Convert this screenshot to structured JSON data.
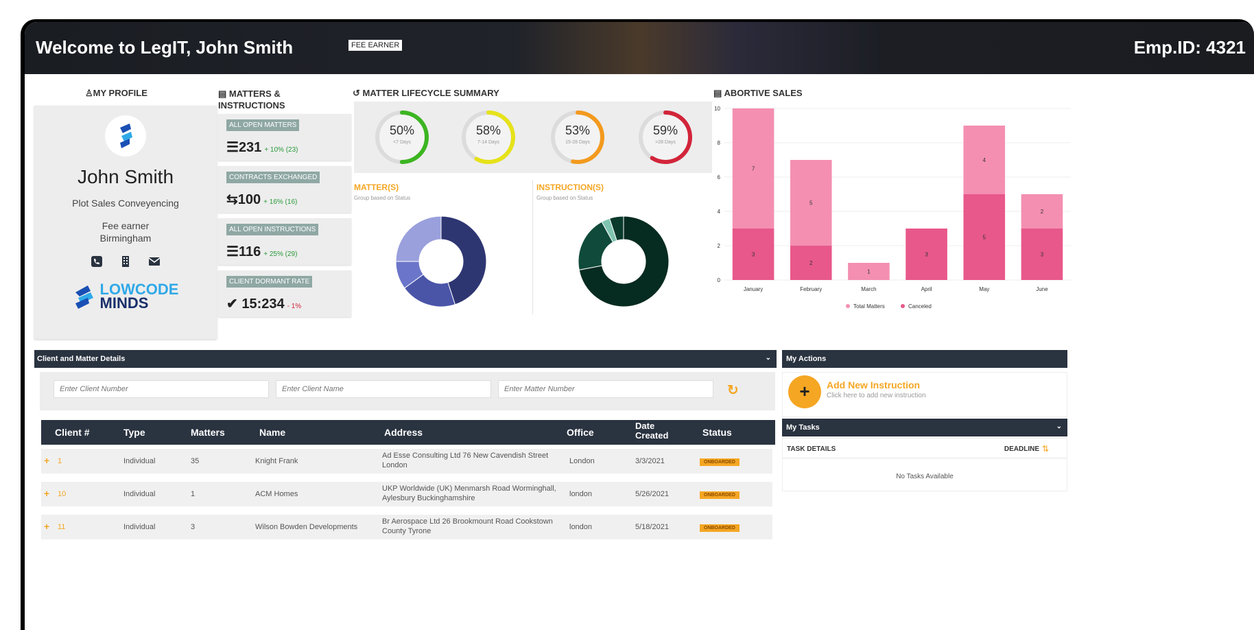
{
  "header": {
    "welcome": "Welcome to LegIT, John Smith",
    "role_badge": "FEE EARNER",
    "emp_id": "Emp.ID: 4321"
  },
  "profile": {
    "section_title": "MY PROFILE",
    "name": "John Smith",
    "department": "Plot Sales Conveyencing",
    "title": "Fee earner",
    "location": "Birmingham",
    "logo_line1": "LOWCODE",
    "logo_line2": "MINDS"
  },
  "matters": {
    "section_title_1": "MATTERS &",
    "section_title_2": "INSTRUCTIONS",
    "cards": [
      {
        "label": "ALL OPEN MATTERS",
        "value": "231",
        "delta": "+ 10% (23)",
        "icon": "list-icon"
      },
      {
        "label": "CONTRACTS EXCHANGED",
        "value": "100",
        "delta": "+ 16% (16)",
        "icon": "exchange-icon"
      },
      {
        "label": "ALL OPEN INSTRUCTIONS",
        "value": "116",
        "delta": "+ 25% (29)",
        "icon": "list-icon"
      },
      {
        "label": "CLIENT DORMANT RATE",
        "value": "15:234",
        "delta": "- 1%",
        "icon": "check-circle-icon"
      }
    ]
  },
  "lifecycle": {
    "section_title": "MATTER LIFECYCLE SUMMARY",
    "gauges": [
      {
        "pct": "50%",
        "sub": "<7 Days",
        "value": 50,
        "color": "#3cb521"
      },
      {
        "pct": "58%",
        "sub": "7-14 Days",
        "value": 58,
        "color": "#e6e21a"
      },
      {
        "pct": "53%",
        "sub": "15-28 Days",
        "value": 53,
        "color": "#f39a1e"
      },
      {
        "pct": "59%",
        "sub": ">28 Days",
        "value": 59,
        "color": "#d2253a"
      }
    ],
    "matters_title": "MATTER(S)",
    "matters_sub": "Group based on Status",
    "instructions_title": "INSTRUCTION(S)",
    "instructions_sub": "Group based on Status",
    "matters_donut": [
      {
        "value": 45,
        "color": "#2e3672"
      },
      {
        "value": 20,
        "color": "#4a55a8"
      },
      {
        "value": 10,
        "color": "#6b75c9"
      },
      {
        "value": 25,
        "color": "#9aa0dc"
      }
    ],
    "instructions_donut": [
      {
        "value": 72,
        "color": "#062b20"
      },
      {
        "value": 20,
        "color": "#0f4a3a"
      },
      {
        "value": 3,
        "color": "#7fc4b0"
      },
      {
        "value": 5,
        "color": "#0a3a2c"
      }
    ]
  },
  "chart_data": {
    "type": "bar",
    "title": "ABORTIVE SALES",
    "categories": [
      "January",
      "February",
      "March",
      "April",
      "May",
      "June"
    ],
    "series": [
      {
        "name": "Total Matters",
        "values": [
          7,
          5,
          1,
          0,
          4,
          2
        ],
        "color": "#f48fb1"
      },
      {
        "name": "Canceled",
        "values": [
          3,
          2,
          0,
          3,
          5,
          3
        ],
        "color": "#e8588a"
      }
    ],
    "stacked": true,
    "ylim": [
      0,
      10
    ],
    "yticks": [
      0,
      2,
      4,
      6,
      8,
      10
    ],
    "legend": "bottom"
  },
  "client_panel": {
    "title": "Client and Matter Details",
    "client_number_placeholder": "Enter Client Number",
    "client_name_placeholder": "Enter Client Name",
    "matter_number_placeholder": "Enter Matter Number",
    "columns": [
      "Client #",
      "Type",
      "Matters",
      "Name",
      "Address",
      "Office",
      "Date Created",
      "Status"
    ],
    "rows": [
      {
        "client": "1",
        "type": "Individual",
        "matters": "35",
        "name": "Knight Frank",
        "address": "Ad Esse Consulting Ltd 76 New Cavendish Street London",
        "office": "London",
        "date": "3/3/2021",
        "status": "ONBOARDED"
      },
      {
        "client": "10",
        "type": "Individual",
        "matters": "1",
        "name": "ACM Homes",
        "address": "UKP Worldwide (UK) Menmarsh Road Worminghall, Aylesbury Buckinghamshire",
        "office": "london",
        "date": "5/26/2021",
        "status": "ONBOARDED"
      },
      {
        "client": "11",
        "type": "Individual",
        "matters": "3",
        "name": "Wilson Bowden Developments",
        "address": "Br Aerospace Ltd 26 Brookmount Road Cookstown County Tyrone",
        "office": "london",
        "date": "5/18/2021",
        "status": "ONBOARDED"
      }
    ]
  },
  "actions": {
    "title": "My Actions",
    "add_title": "Add New Instruction",
    "add_sub": "Click here to add new instruction"
  },
  "tasks": {
    "title": "My Tasks",
    "col_details": "TASK DETAILS",
    "col_deadline": "DEADLINE",
    "empty": "No Tasks Available"
  }
}
